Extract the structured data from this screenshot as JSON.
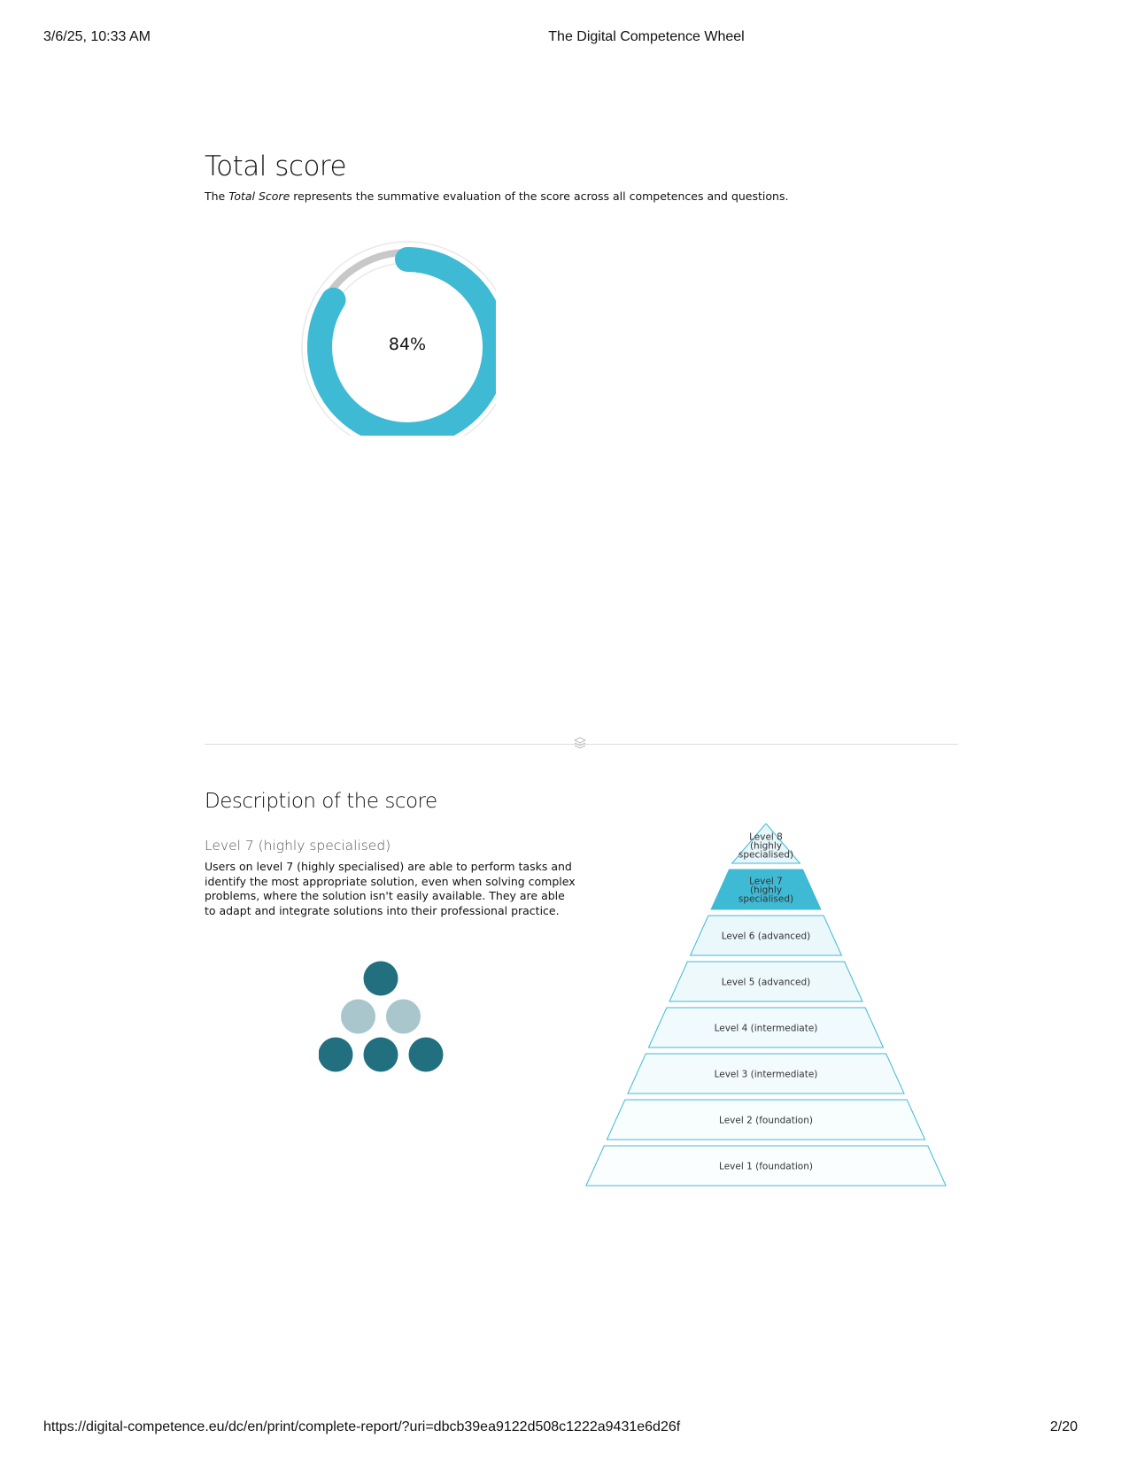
{
  "print_header": {
    "date": "3/6/25, 10:33 AM",
    "title": "The Digital Competence Wheel"
  },
  "print_footer": {
    "url": "https://digital-competence.eu/dc/en/print/complete-report/?uri=dbcb39ea9122d508c1222a9431e6d26f",
    "page": "2/20"
  },
  "total_score": {
    "title": "Total score",
    "intro_prefix": "The ",
    "intro_emph": "Total Score",
    "intro_suffix": " represents the summative evaluation of the score across all competences and questions.",
    "score_label": "84%",
    "score_fraction": 0.84,
    "colors": {
      "ring": "#3fbad5",
      "track": "#c8c8c8"
    }
  },
  "description": {
    "title": "Description of the score",
    "level_heading": "Level 7 (highly specialised)",
    "level_text": "Users on level 7 (highly specialised) are able to perform tasks and identify the most appropriate solution, even when solving complex problems, where the solution isn't easily available. They are able to adapt and integrate solutions into their professional practice.",
    "dots": {
      "colors": {
        "filled": "#216f7f",
        "empty": "#a9c6cd"
      },
      "rows": [
        [
          1
        ],
        [
          0,
          0
        ],
        [
          1,
          1,
          1
        ]
      ]
    },
    "pyramid": {
      "highlight_color": "#3fbad5",
      "levels": [
        {
          "lines": [
            "Level 8",
            "(highly",
            "specialised)"
          ],
          "active": false
        },
        {
          "lines": [
            "Level 7",
            "(highly",
            "specialised)"
          ],
          "active": true
        },
        {
          "lines": [
            "Level 6 (advanced)"
          ],
          "active": false
        },
        {
          "lines": [
            "Level 5 (advanced)"
          ],
          "active": false
        },
        {
          "lines": [
            "Level 4 (intermediate)"
          ],
          "active": false
        },
        {
          "lines": [
            "Level 3 (intermediate)"
          ],
          "active": false
        },
        {
          "lines": [
            "Level 2 (foundation)"
          ],
          "active": false
        },
        {
          "lines": [
            "Level 1 (foundation)"
          ],
          "active": false
        }
      ]
    }
  }
}
